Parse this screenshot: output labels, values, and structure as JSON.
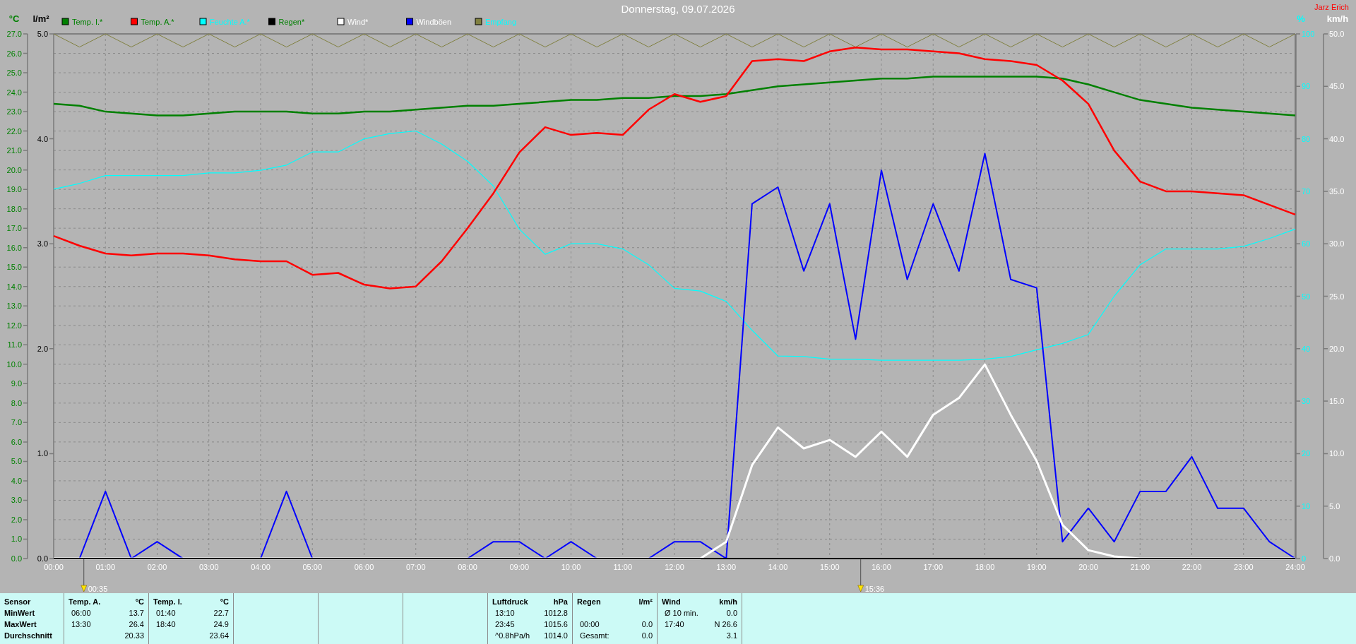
{
  "user": "Jarz Erich",
  "chart": {
    "axes": [
      {
        "unit": "°C",
        "color": "#008000"
      },
      {
        "unit": "l/m²",
        "color": "#000000",
        "ticks": [
          "5.0",
          "4.0",
          "3.0",
          "2.0",
          "1.0",
          "0.0"
        ]
      },
      {
        "unit": "%",
        "color": "#00ffff"
      },
      {
        "unit": "km/h",
        "color": "#ffffff"
      }
    ],
    "chart_data": {
      "type": "line",
      "title": "Donnerstag, 09.07.2026",
      "xlim": [
        0,
        24
      ],
      "ylim": [
        0,
        27
      ],
      "y2lim": [
        0,
        100
      ],
      "y3lim": [
        0,
        50
      ],
      "yticks": [
        {
          "value": 27,
          "label": "27.0"
        },
        {
          "value": 26,
          "label": "26.0"
        },
        {
          "value": 25,
          "label": "25.0"
        },
        {
          "value": 24,
          "label": "24.0"
        },
        {
          "value": 23,
          "label": "23.0"
        },
        {
          "value": 22,
          "label": "22.0"
        },
        {
          "value": 21,
          "label": "21.0"
        },
        {
          "value": 20,
          "label": "20.0"
        },
        {
          "value": 19,
          "label": "19.0"
        },
        {
          "value": 18,
          "label": "18.0"
        },
        {
          "value": 17,
          "label": "17.0"
        },
        {
          "value": 16,
          "label": "16.0"
        },
        {
          "value": 15,
          "label": "15.0"
        },
        {
          "value": 14,
          "label": "14.0"
        },
        {
          "value": 13,
          "label": "13.0"
        },
        {
          "value": 12,
          "label": "12.0"
        },
        {
          "value": 11,
          "label": "11.0"
        },
        {
          "value": 10,
          "label": "10.0"
        },
        {
          "value": 9,
          "label": "9.0"
        },
        {
          "value": 8,
          "label": "8.0"
        },
        {
          "value": 7,
          "label": "7.0"
        },
        {
          "value": 6,
          "label": "6.0"
        },
        {
          "value": 5,
          "label": "5.0"
        },
        {
          "value": 4,
          "label": "4.0"
        },
        {
          "value": 3,
          "label": "3.0"
        },
        {
          "value": 2,
          "label": "2.0"
        },
        {
          "value": 1,
          "label": "1.0"
        },
        {
          "value": 0,
          "label": "0.0"
        }
      ],
      "y2ticks": [
        {
          "value": 100,
          "label": "100"
        },
        {
          "value": 90,
          "label": "90"
        },
        {
          "value": 80,
          "label": "80"
        },
        {
          "value": 70,
          "label": "70"
        },
        {
          "value": 60,
          "label": "60"
        },
        {
          "value": 50,
          "label": "50"
        },
        {
          "value": 40,
          "label": "40"
        },
        {
          "value": 30,
          "label": "30"
        },
        {
          "value": 20,
          "label": "20"
        },
        {
          "value": 10,
          "label": "10"
        },
        {
          "value": 0,
          "label": "0"
        }
      ],
      "y3ticks": [
        {
          "value": 50,
          "label": "50.0"
        },
        {
          "value": 45,
          "label": "45.0"
        },
        {
          "value": 40,
          "label": "40.0"
        },
        {
          "value": 35,
          "label": "35.0"
        },
        {
          "value": 30,
          "label": "30.0"
        },
        {
          "value": 25,
          "label": "25.0"
        },
        {
          "value": 20,
          "label": "20.0"
        },
        {
          "value": 15,
          "label": "15.0"
        },
        {
          "value": 10,
          "label": "10.0"
        },
        {
          "value": 5,
          "label": "5.0"
        },
        {
          "value": 0,
          "label": "0.0"
        }
      ],
      "x": [
        0,
        0.5,
        1,
        1.5,
        2,
        2.5,
        3,
        3.5,
        4,
        4.5,
        5,
        5.5,
        6,
        6.5,
        7,
        7.5,
        8,
        8.5,
        9,
        9.5,
        10,
        10.5,
        11,
        11.5,
        12,
        12.5,
        13,
        13.5,
        14,
        14.5,
        15,
        15.5,
        16,
        16.5,
        17,
        17.5,
        18,
        18.5,
        19,
        19.5,
        20,
        20.5,
        21,
        21.5,
        22,
        22.5,
        23,
        23.5,
        24
      ],
      "xticks": [
        {
          "value": 0,
          "label": "00:00"
        },
        {
          "value": 1,
          "label": "01:00"
        },
        {
          "value": 2,
          "label": "02:00"
        },
        {
          "value": 3,
          "label": "03:00"
        },
        {
          "value": 4,
          "label": "04:00"
        },
        {
          "value": 5,
          "label": "05:00"
        },
        {
          "value": 6,
          "label": "06:00"
        },
        {
          "value": 7,
          "label": "07:00"
        },
        {
          "value": 8,
          "label": "08:00"
        },
        {
          "value": 9,
          "label": "09:00"
        },
        {
          "value": 10,
          "label": "10:00"
        },
        {
          "value": 11,
          "label": "11:00"
        },
        {
          "value": 12,
          "label": "12:00"
        },
        {
          "value": 13,
          "label": "13:00"
        },
        {
          "value": 14,
          "label": "14:00"
        },
        {
          "value": 15,
          "label": "15:00"
        },
        {
          "value": 16,
          "label": "16:00"
        },
        {
          "value": 17,
          "label": "17:00"
        },
        {
          "value": 18,
          "label": "18:00"
        },
        {
          "value": 19,
          "label": "19:00"
        },
        {
          "value": 20,
          "label": "20:00"
        },
        {
          "value": 21,
          "label": "21:00"
        },
        {
          "value": 22,
          "label": "22:00"
        },
        {
          "value": 23,
          "label": "23:00"
        },
        {
          "value": 24,
          "label": "24:00"
        }
      ],
      "series": [
        {
          "name": "Temp. I.*",
          "color": "#008000",
          "values": [
            23.4,
            23.3,
            23.0,
            22.9,
            22.8,
            22.8,
            22.9,
            23.0,
            23.0,
            23.0,
            22.9,
            22.9,
            23.0,
            23.0,
            23.1,
            23.2,
            23.3,
            23.3,
            23.4,
            23.5,
            23.6,
            23.6,
            23.7,
            23.7,
            23.8,
            23.8,
            23.9,
            24.1,
            24.3,
            24.4,
            24.5,
            24.6,
            24.7,
            24.7,
            24.8,
            24.8,
            24.8,
            24.8,
            24.8,
            24.7,
            24.4,
            24.0,
            23.6,
            23.4,
            23.2,
            23.1,
            23.0,
            22.9,
            22.8
          ]
        },
        {
          "name": "Temp. A.*",
          "color": "#ff0000",
          "values": [
            16.6,
            16.1,
            15.7,
            15.6,
            15.7,
            15.7,
            15.6,
            15.4,
            15.3,
            15.3,
            14.6,
            14.7,
            14.1,
            13.9,
            14.0,
            15.3,
            17.0,
            18.8,
            20.9,
            22.2,
            21.8,
            21.9,
            21.8,
            23.1,
            23.9,
            23.5,
            23.8,
            25.6,
            25.7,
            25.6,
            26.1,
            26.3,
            26.2,
            26.2,
            26.1,
            26.0,
            25.7,
            25.6,
            25.4,
            24.6,
            23.4,
            21.0,
            19.4,
            18.9,
            18.9,
            18.8,
            18.7,
            18.2,
            17.7
          ]
        },
        {
          "name": "Feuchte A.*",
          "color": "#00ffff",
          "axis": "y2",
          "values": [
            70.4,
            71.5,
            73,
            73,
            73,
            73,
            73.5,
            73.5,
            74,
            75,
            77.5,
            77.5,
            80,
            81,
            81.5,
            79,
            75.7,
            71,
            62.8,
            58,
            60,
            60,
            59,
            56,
            51.5,
            51,
            49,
            43.5,
            38.6,
            38.5,
            38,
            38,
            37.8,
            37.8,
            37.8,
            37.8,
            38,
            38.5,
            39.8,
            41,
            42.7,
            50,
            56,
            59,
            59,
            59,
            59.5,
            61,
            62.8
          ]
        },
        {
          "name": "Regen*",
          "color": "#000000",
          "values": [
            0,
            0,
            0,
            0,
            0,
            0,
            0,
            0,
            0,
            0,
            0,
            0,
            0,
            0,
            0,
            0,
            0,
            0,
            0,
            0,
            0,
            0,
            0,
            0,
            0,
            0,
            0,
            0,
            0,
            0,
            0,
            0,
            0,
            0,
            0,
            0,
            0,
            0,
            0,
            0,
            0,
            0,
            0,
            0,
            0,
            0,
            0,
            0,
            0
          ]
        },
        {
          "name": "Wind*",
          "color": "#ffffff",
          "axis": "y3",
          "values": [
            0,
            0,
            0,
            0,
            0,
            0,
            0,
            0,
            0,
            0,
            0,
            0,
            0,
            0,
            0,
            0,
            0,
            0,
            0,
            0,
            0,
            0,
            0,
            0,
            0,
            0,
            1.6,
            8.9,
            12.5,
            10.5,
            11.3,
            9.7,
            12.1,
            9.7,
            13.7,
            15.3,
            18.5,
            13.7,
            9.3,
            3.2,
            0.8,
            0.2,
            0,
            0,
            0,
            0,
            0,
            0,
            0
          ]
        },
        {
          "name": "Windböen",
          "color": "#0000ff",
          "axis": "y3",
          "values": [
            0,
            0,
            6.4,
            0,
            1.6,
            0,
            0,
            0,
            0,
            6.4,
            0,
            0,
            0,
            0,
            0,
            0,
            0,
            1.6,
            1.6,
            0,
            1.6,
            0,
            0,
            0,
            1.6,
            1.6,
            0,
            33.8,
            35.4,
            27.4,
            33.8,
            20.9,
            37,
            26.6,
            33.8,
            27.4,
            38.6,
            26.6,
            25.8,
            1.6,
            4.8,
            1.6,
            6.4,
            6.4,
            9.7,
            4.8,
            4.8,
            1.6,
            0
          ]
        },
        {
          "name": "Empfang",
          "color": "#808040",
          "axis": "y2",
          "values": [
            100,
            97.5,
            100,
            97.5,
            100,
            97.5,
            100,
            97.5,
            100,
            97.5,
            100,
            97.5,
            100,
            97.5,
            100,
            97.5,
            100,
            97.5,
            100,
            97.5,
            100,
            97.5,
            100,
            97.5,
            100,
            97.5,
            100,
            97.5,
            100,
            97.5,
            100,
            97.5,
            100,
            97.5,
            100,
            97.5,
            100,
            97.5,
            100,
            97.5,
            100,
            97.5,
            100,
            97.5,
            100,
            97.5,
            100,
            97.5,
            100
          ]
        }
      ],
      "grid": true,
      "legend": true,
      "annotations": [
        "00:35",
        "15:36"
      ]
    }
  },
  "sensor_table": {
    "columns": [
      {
        "kind": "labels",
        "cells": [
          "Sensor",
          "MinWert",
          "MaxWert",
          "Durchschnitt"
        ]
      },
      {
        "kind": "data",
        "title": "Temp. A.",
        "unit": "°C",
        "rows": [
          {
            "time": "06:00",
            "value": "13.7"
          },
          {
            "time": "13:30",
            "value": "26.4"
          },
          {
            "value": "20.33"
          }
        ]
      },
      {
        "kind": "data",
        "title": "Temp. I.",
        "unit": "°C",
        "rows": [
          {
            "time": "01:40",
            "value": "22.7"
          },
          {
            "time": "18:40",
            "value": "24.9"
          },
          {
            "value": "23.64"
          }
        ]
      },
      {
        "kind": "blank"
      },
      {
        "kind": "blank"
      },
      {
        "kind": "blank"
      },
      {
        "kind": "data",
        "title": "Luftdruck",
        "unit": "hPa",
        "rows": [
          {
            "time": "13:10",
            "value": "1012.8"
          },
          {
            "time": "23:45",
            "value": "1015.6"
          },
          {
            "time": "^0.8hPa/h",
            "value": "1014.0"
          }
        ]
      },
      {
        "kind": "data",
        "title": "Regen",
        "unit": "l/m²",
        "rows": [
          {},
          {
            "time": "00:00",
            "value": "0.0"
          },
          {
            "time": "Gesamt:",
            "value": "0.0"
          }
        ]
      },
      {
        "kind": "data",
        "title": "Wind",
        "unit": "km/h",
        "rows": [
          {
            "time": "Ø 10 min.",
            "value": "0.0"
          },
          {
            "time": "17:40",
            "value": "N 26.6"
          },
          {
            "value": "3.1"
          }
        ]
      },
      {
        "kind": "blank"
      }
    ]
  }
}
